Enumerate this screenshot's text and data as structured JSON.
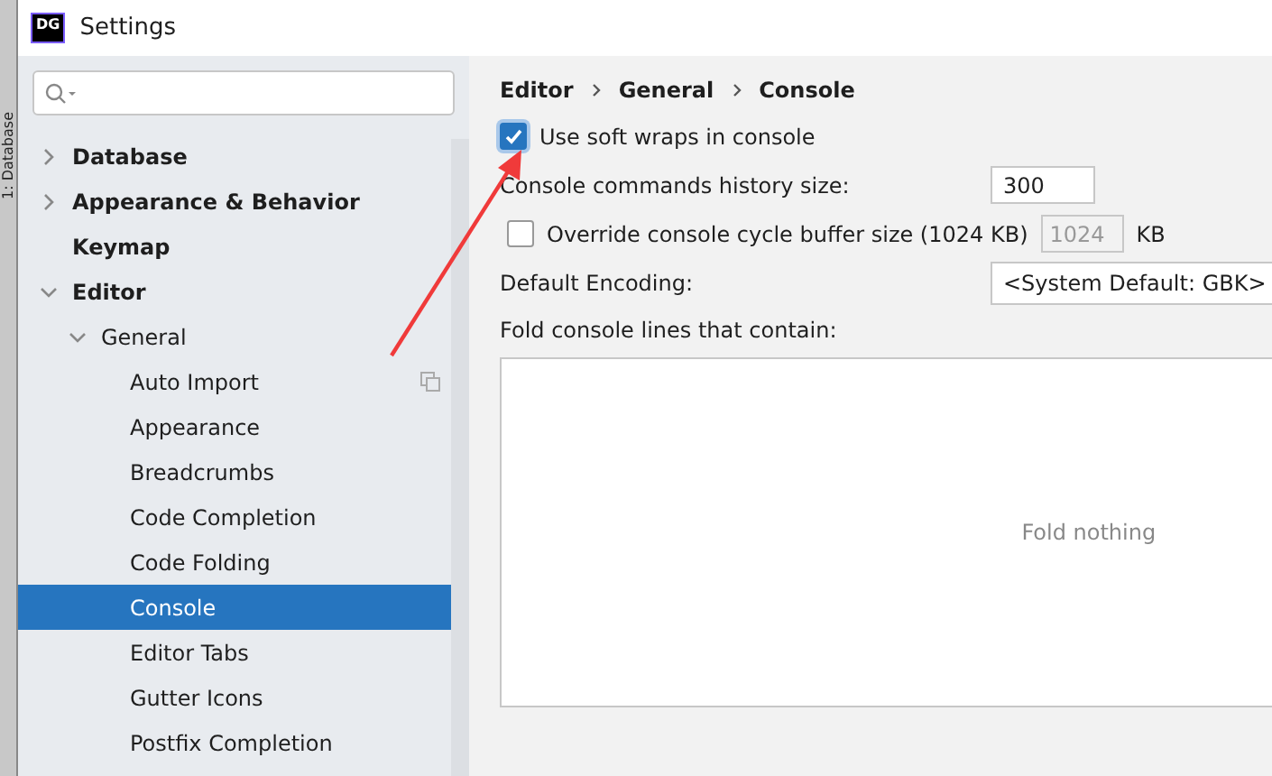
{
  "window": {
    "title": "Settings",
    "logo": "DG"
  },
  "background_tool_tab": "1: Database",
  "sidebar": {
    "items": [
      {
        "label": "Database",
        "expanded": false,
        "selected": false
      },
      {
        "label": "Appearance & Behavior",
        "expanded": false,
        "selected": false
      },
      {
        "label": "Keymap",
        "selected": false
      },
      {
        "label": "Editor",
        "expanded": true,
        "selected": false,
        "children": [
          {
            "label": "General",
            "expanded": true,
            "selected": false,
            "children": [
              {
                "label": "Auto Import",
                "selected": false,
                "project_icon": true
              },
              {
                "label": "Appearance",
                "selected": false
              },
              {
                "label": "Breadcrumbs",
                "selected": false
              },
              {
                "label": "Code Completion",
                "selected": false
              },
              {
                "label": "Code Folding",
                "selected": false
              },
              {
                "label": "Console",
                "selected": true
              },
              {
                "label": "Editor Tabs",
                "selected": false
              },
              {
                "label": "Gutter Icons",
                "selected": false
              },
              {
                "label": "Postfix Completion",
                "selected": false
              }
            ]
          }
        ]
      }
    ]
  },
  "breadcrumb": [
    "Editor",
    "General",
    "Console"
  ],
  "settings": [
    {
      "kind": "checkbox",
      "label": "Use soft wraps in console",
      "checked": true
    },
    {
      "kind": "number",
      "label": "Console commands history size:",
      "value": "300",
      "disabled": false
    },
    {
      "kind": "checkbox-number",
      "label": "Override console cycle buffer size (1024 KB)",
      "checked": false,
      "value": "1024",
      "disabled": true,
      "unit": "KB"
    },
    {
      "kind": "dropdown",
      "label": "Default Encoding:",
      "value": "<System Default: GBK>"
    }
  ],
  "fold_list": {
    "label": "Fold console lines that contain:",
    "empty_text": "Fold nothing"
  }
}
